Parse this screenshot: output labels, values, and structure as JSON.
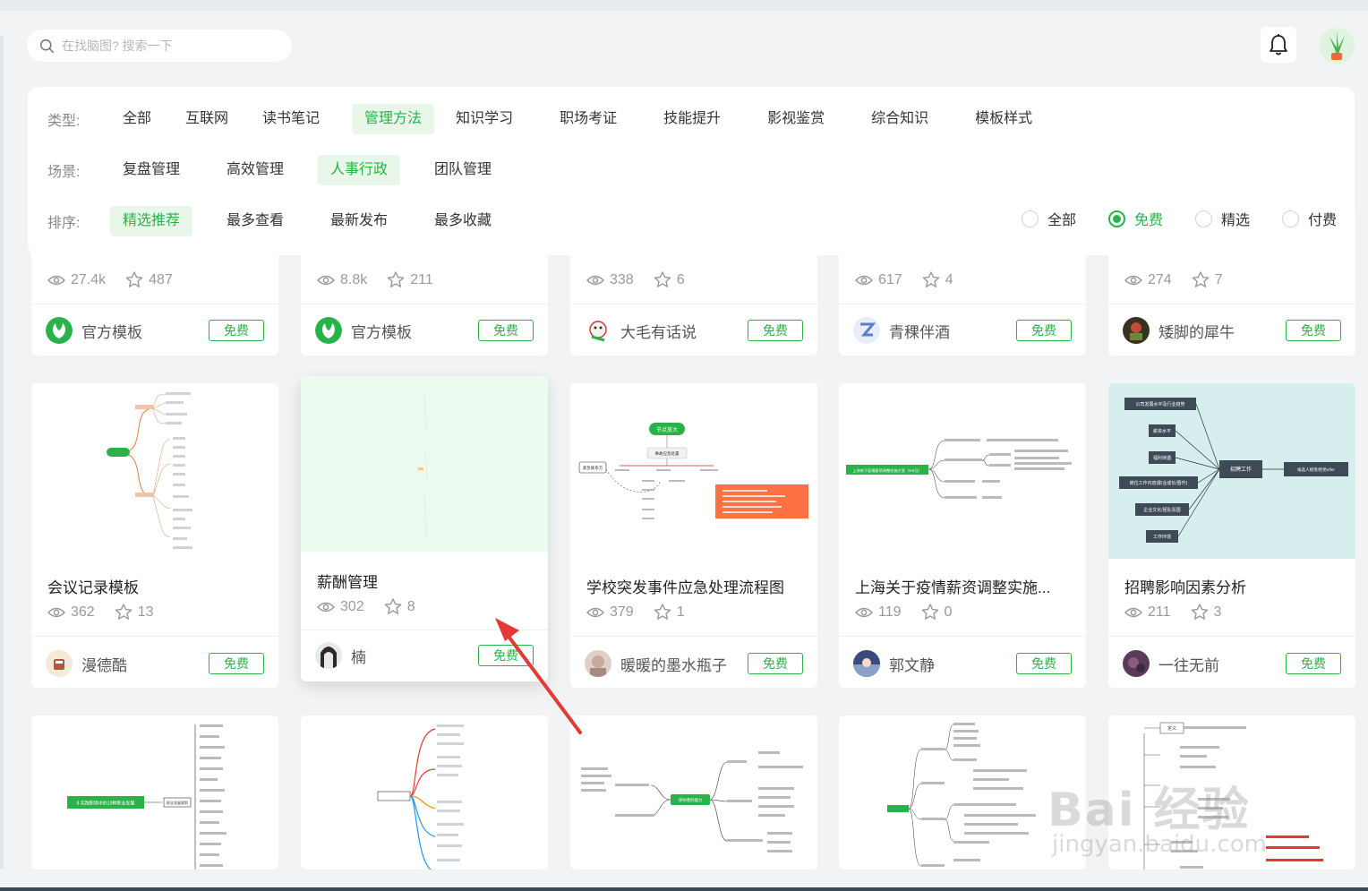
{
  "search": {
    "placeholder": "在找脑图? 搜索一下"
  },
  "filters": {
    "type_label": "类型:",
    "types": [
      "全部",
      "互联网",
      "读书笔记",
      "管理方法",
      "知识学习",
      "职场考证",
      "技能提升",
      "影视鉴赏",
      "综合知识",
      "模板样式"
    ],
    "active_type": "管理方法",
    "scene_label": "场景:",
    "scenes": [
      "复盘管理",
      "高效管理",
      "人事行政",
      "团队管理"
    ],
    "active_scene": "人事行政",
    "sort_label": "排序:",
    "sorts": [
      "精选推荐",
      "最多查看",
      "最新发布",
      "最多收藏"
    ],
    "active_sort": "精选推荐",
    "price_options": [
      "全部",
      "免费",
      "精选",
      "付费"
    ],
    "active_price": "免费"
  },
  "free_label": "免费",
  "cards_row1": [
    {
      "views": "27.4k",
      "stars": "487",
      "author": "官方模板"
    },
    {
      "views": "8.8k",
      "stars": "211",
      "author": "官方模板"
    },
    {
      "views": "338",
      "stars": "6",
      "author": "大毛有话说"
    },
    {
      "views": "617",
      "stars": "4",
      "author": "青稞伴酒"
    },
    {
      "views": "274",
      "stars": "7",
      "author": "矮脚的犀牛"
    }
  ],
  "cards_row2": [
    {
      "title": "会议记录模板",
      "views": "362",
      "stars": "13",
      "author": "漫德酷"
    },
    {
      "title": "薪酬管理",
      "views": "302",
      "stars": "8",
      "author": "楠"
    },
    {
      "title": "学校突发事件应急处理流程图",
      "views": "379",
      "stars": "1",
      "author": "暖暖的墨水瓶子"
    },
    {
      "title": "上海关于疫情薪资调整实施...",
      "views": "119",
      "stars": "0",
      "author": "郭文静"
    },
    {
      "title": "招聘影响因素分析",
      "views": "211",
      "stars": "3",
      "author": "一往无前"
    }
  ],
  "thumb_texts": {
    "c3_top": "节点放大",
    "c3_sub": "事故应急处置",
    "c3_left": "紧急联系方",
    "c5_nodes": [
      "公司发展水平及行业趋势",
      "薪资水平",
      "福利待遇",
      "岗位工作内容(职业成长/晋升)",
      "企业文化/团队氛围",
      "工作环境"
    ],
    "c5_center": "招聘工作",
    "c5_right": "候选人接受/拒绝offer",
    "c4_center": "上海关于疫情薪资调整实施方案（6-8月）",
    "r3c1_center": "8 实践职场中的10种职业发展",
    "r3c1_right": "职业发展规划",
    "r3c3_center": "领导者的能力",
    "r3c5_top": "定义"
  },
  "watermark": {
    "main": "Bai 经验",
    "sub": "jingyan.baidu.com"
  },
  "colors": {
    "accent": "#2ab24a",
    "accent_bg": "#e8f7ea",
    "arrow": "#e53935"
  }
}
